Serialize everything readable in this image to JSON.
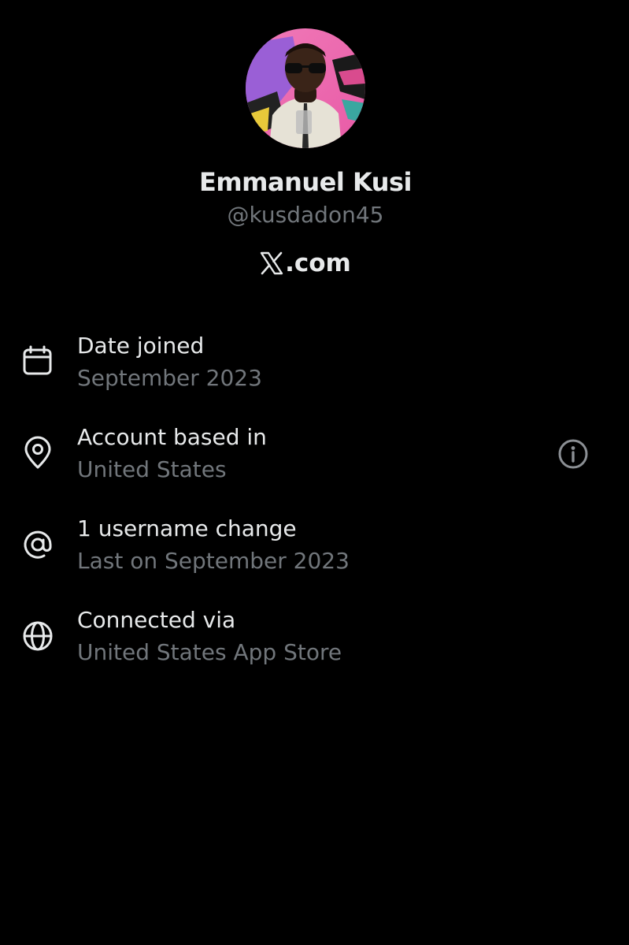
{
  "profile": {
    "display_name": "Emmanuel Kusi",
    "handle": "@kusdadon45",
    "brand": ".com"
  },
  "about": {
    "rows": [
      {
        "icon": "calendar-icon",
        "title": "Date joined",
        "subtitle": "September 2023"
      },
      {
        "icon": "location-pin-icon",
        "title": "Account based in",
        "subtitle": "United States"
      },
      {
        "icon": "at-sign-icon",
        "title": "1 username change",
        "subtitle": "Last on September 2023"
      },
      {
        "icon": "globe-icon",
        "title": "Connected via",
        "subtitle": "United States App Store"
      }
    ]
  },
  "colors": {
    "background": "#000000",
    "primary_text": "#e7e9ea",
    "secondary_text": "#71767b"
  }
}
